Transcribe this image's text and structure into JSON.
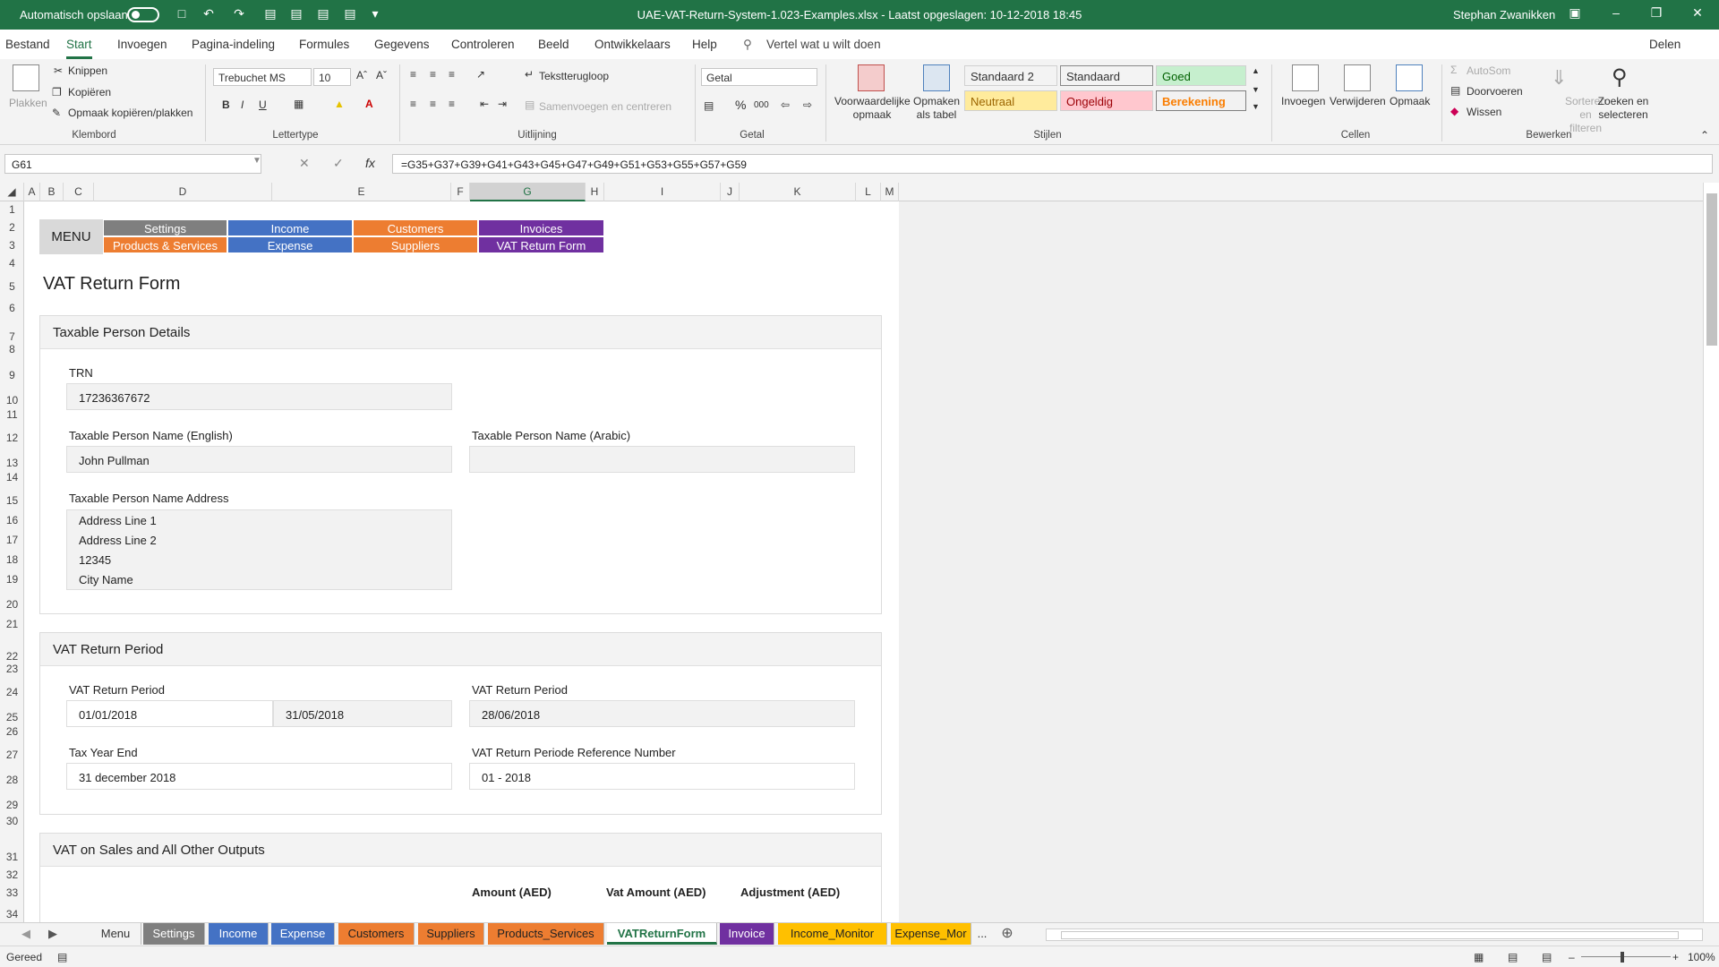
{
  "titlebar": {
    "autosave_label": "Automatisch opslaan",
    "title": "UAE-VAT-Return-System-1.023-Examples.xlsx  -  Laatst opgeslagen: 10-12-2018 18:45",
    "user": "Stephan Zwanikken"
  },
  "menu": {
    "tabs": [
      "Bestand",
      "Start",
      "Invoegen",
      "Pagina-indeling",
      "Formules",
      "Gegevens",
      "Controleren",
      "Beeld",
      "Ontwikkelaars",
      "Help"
    ],
    "active": "Start",
    "tell_me": "Vertel wat u wilt doen",
    "share": "Delen"
  },
  "ribbon": {
    "clipboard": {
      "paste": "Plakken",
      "cut": "Knippen",
      "copy": "Kopiëren",
      "format_painter": "Opmaak kopiëren/plakken",
      "label": "Klembord"
    },
    "font": {
      "name": "Trebuchet MS",
      "size": "10",
      "bold": "B",
      "italic": "I",
      "underline": "U",
      "label": "Lettertype"
    },
    "alignment": {
      "wrap": "Tekstterugloop",
      "merge": "Samenvoegen en centreren",
      "label": "Uitlijning"
    },
    "number": {
      "format": "Getal",
      "percent": "%",
      "thousands": "000",
      "label": "Getal"
    },
    "styles": {
      "conditional": "Voorwaardelijke opmaak",
      "as_table": "Opmaken als tabel",
      "cells": [
        {
          "text": "Standaard 2",
          "bg": "#ffffff",
          "fg": "#222222"
        },
        {
          "text": "Standaard",
          "bg": "#ffffff",
          "fg": "#222222"
        },
        {
          "text": "Goed",
          "bg": "#c6efce",
          "fg": "#006100"
        },
        {
          "text": "Neutraal",
          "bg": "#ffeb9c",
          "fg": "#9c6500"
        },
        {
          "text": "Ongeldig",
          "bg": "#ffc7ce",
          "fg": "#9c0006"
        },
        {
          "text": "Berekening",
          "bg": "#f2f2f2",
          "fg": "#fa7d00"
        }
      ],
      "label": "Stijlen"
    },
    "cells": {
      "insert": "Invoegen",
      "delete": "Verwijderen",
      "format": "Opmaak",
      "label": "Cellen"
    },
    "editing": {
      "autosum": "AutoSom",
      "fill": "Doorvoeren",
      "clear": "Wissen",
      "sort": "Sorteren en filteren",
      "find": "Zoeken en selecteren",
      "label": "Bewerken"
    }
  },
  "formula_bar": {
    "name_box": "G61",
    "fx": "fx",
    "formula": "=G35+G37+G39+G41+G43+G45+G47+G49+G51+G53+G55+G57+G59"
  },
  "columns": [
    "A",
    "B",
    "C",
    "D",
    "E",
    "F",
    "G",
    "H",
    "I",
    "J",
    "K",
    "L",
    "M"
  ],
  "selected_column": "G",
  "rows": [
    "1",
    "2",
    "3",
    "4",
    "5",
    "6",
    "7",
    "8",
    "9",
    "10",
    "11",
    "12",
    "13",
    "14",
    "15",
    "16",
    "17",
    "18",
    "19",
    "20",
    "21",
    "22",
    "23",
    "24",
    "25",
    "26",
    "27",
    "28",
    "29",
    "30",
    "31",
    "32",
    "33",
    "34"
  ],
  "nav_menu": {
    "label": "MENU",
    "buttons": [
      {
        "text": "Settings",
        "bg": "#7f7f7f"
      },
      {
        "text": "Income",
        "bg": "#4472c4"
      },
      {
        "text": "Customers",
        "bg": "#ed7d31"
      },
      {
        "text": "Invoices",
        "bg": "#7030a0"
      },
      {
        "text": "Products & Services",
        "bg": "#ed7d31"
      },
      {
        "text": "Expense",
        "bg": "#4472c4"
      },
      {
        "text": "Suppliers",
        "bg": "#ed7d31"
      },
      {
        "text": "VAT Return Form",
        "bg": "#7030a0"
      }
    ]
  },
  "form": {
    "title": "VAT Return Form",
    "taxable": {
      "heading": "Taxable Person Details",
      "trn_label": "TRN",
      "trn": "17236367672",
      "name_en_label": "Taxable Person Name (English)",
      "name_en": "John Pullman",
      "name_ar_label": "Taxable Person Name (Arabic)",
      "name_ar": "",
      "address_label": "Taxable Person Name Address",
      "address": [
        "Address Line 1",
        "Address Line 2",
        "12345",
        "City Name"
      ]
    },
    "period": {
      "heading": "VAT Return Period",
      "period_label": "VAT Return Period",
      "from": "01/01/2018",
      "to": "31/05/2018",
      "due_label": "VAT Return Period",
      "due": "28/06/2018",
      "tax_year_label": "Tax Year End",
      "tax_year": "31 december 2018",
      "ref_label": "VAT Return Periode Reference Number",
      "ref": "01 - 2018"
    },
    "sales": {
      "heading": "VAT on Sales and All Other Outputs",
      "col_amount": "Amount (AED)",
      "col_vat": "Vat Amount (AED)",
      "col_adjust": "Adjustment (AED)"
    }
  },
  "sheet_tabs": [
    {
      "text": "Menu",
      "bg": "#f3f3f3",
      "fg": "#333333"
    },
    {
      "text": "Settings",
      "bg": "#7f7f7f",
      "fg": "#ffffff"
    },
    {
      "text": "Income",
      "bg": "#4472c4",
      "fg": "#ffffff"
    },
    {
      "text": "Expense",
      "bg": "#4472c4",
      "fg": "#ffffff"
    },
    {
      "text": "Customers",
      "bg": "#ed7d31",
      "fg": "#222222"
    },
    {
      "text": "Suppliers",
      "bg": "#ed7d31",
      "fg": "#222222"
    },
    {
      "text": "Products_Services",
      "bg": "#ed7d31",
      "fg": "#222222"
    },
    {
      "text": "VATReturnForm",
      "bg": "#ffffff",
      "fg": "#217346"
    },
    {
      "text": "Invoice",
      "bg": "#7030a0",
      "fg": "#ffffff"
    },
    {
      "text": "Income_Monitor",
      "bg": "#ffc000",
      "fg": "#222222"
    },
    {
      "text": "Expense_Mor",
      "bg": "#ffc000",
      "fg": "#222222"
    }
  ],
  "sheet_more": "...",
  "status": {
    "ready": "Gereed",
    "zoom": "100%"
  }
}
